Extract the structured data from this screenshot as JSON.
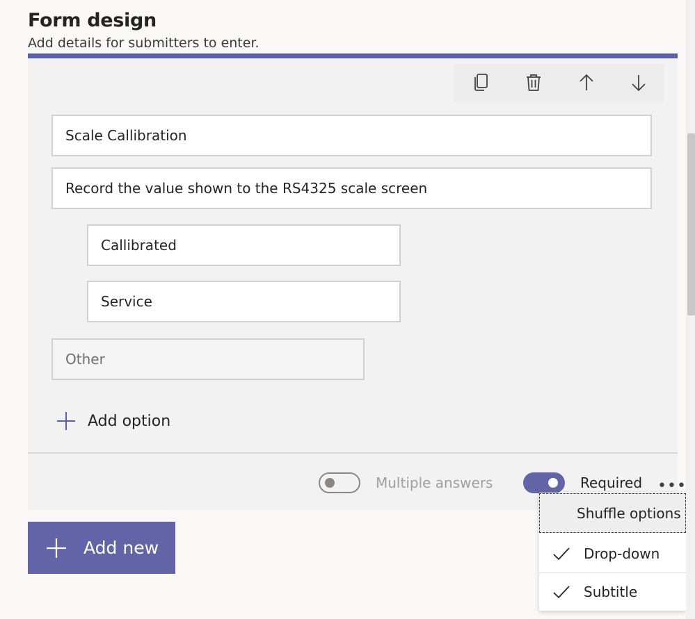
{
  "header": {
    "title": "Form design",
    "subtitle": "Add details for submitters to enter."
  },
  "card": {
    "accent_color": "#5c5fac",
    "toolbar": {
      "icons": [
        "copy-icon",
        "trash-icon",
        "arrow-up-icon",
        "arrow-down-icon"
      ]
    },
    "question_title": "Scale Callibration",
    "question_subtitle": "Record the value shown to the RS4325 scale screen",
    "options": [
      "Callibrated",
      "Service"
    ],
    "other_placeholder": "Other",
    "add_option_label": "Add option",
    "footer": {
      "multiple_answers_label": "Multiple answers",
      "multiple_answers_on": false,
      "required_label": "Required",
      "required_on": true,
      "more_label": "•••"
    }
  },
  "add_new_label": "Add new",
  "menu": {
    "items": [
      {
        "label": "Shuffle options",
        "checked": false
      },
      {
        "label": "Drop-down",
        "checked": true
      },
      {
        "label": "Subtitle",
        "checked": true
      }
    ]
  },
  "colors": {
    "primary": "#6264a7",
    "background": "#f9f8f7",
    "card": "#f2f2f2"
  }
}
